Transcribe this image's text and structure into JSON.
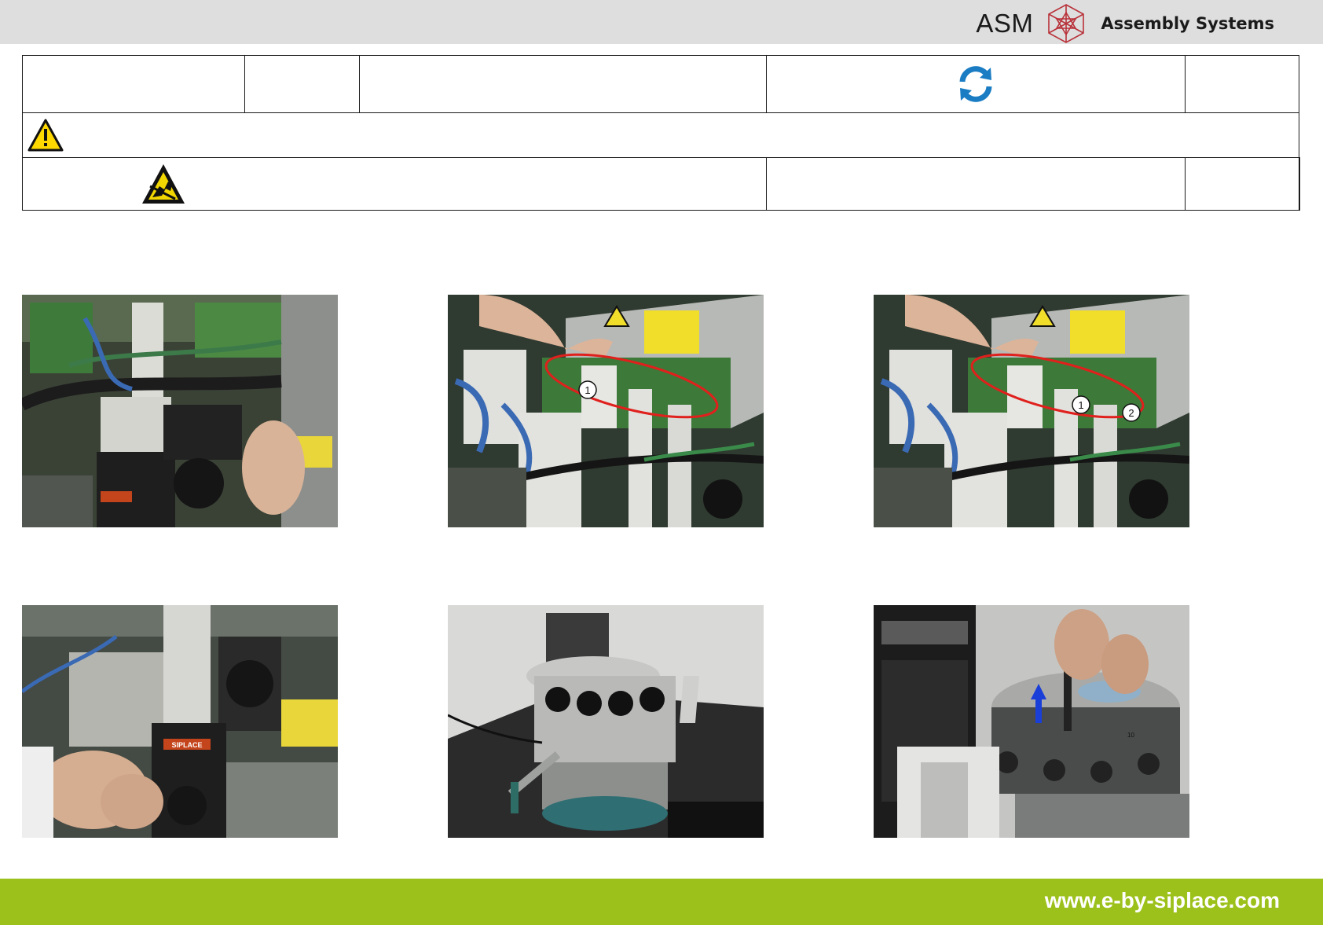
{
  "header": {
    "logo_brand": "ASM",
    "logo_tagline": "Assembly Systems"
  },
  "info_table": {
    "row1": [
      "",
      "",
      "",
      "refresh-icon",
      ""
    ],
    "row2": [
      "warning-icon"
    ],
    "row3": [
      "esd-icon",
      "",
      "",
      ""
    ]
  },
  "photos": [
    {
      "alt": "step-1"
    },
    {
      "alt": "step-2",
      "callouts": [
        "1"
      ]
    },
    {
      "alt": "step-3",
      "callouts": [
        "1",
        "2"
      ]
    },
    {
      "alt": "step-4",
      "labels": [
        "SIPLACE"
      ]
    },
    {
      "alt": "step-5"
    },
    {
      "alt": "step-6",
      "labels": [
        "10"
      ]
    }
  ],
  "colors": {
    "header_bg": "#dedede",
    "footer_bg": "#9dc11b",
    "refresh_blue": "#1a7dc4",
    "warning_yellow": "#ffd800",
    "highlight_red": "#e0201c",
    "arrow_blue": "#1a3ed8"
  },
  "footer": {
    "url": "www.e-by-siplace.com"
  }
}
